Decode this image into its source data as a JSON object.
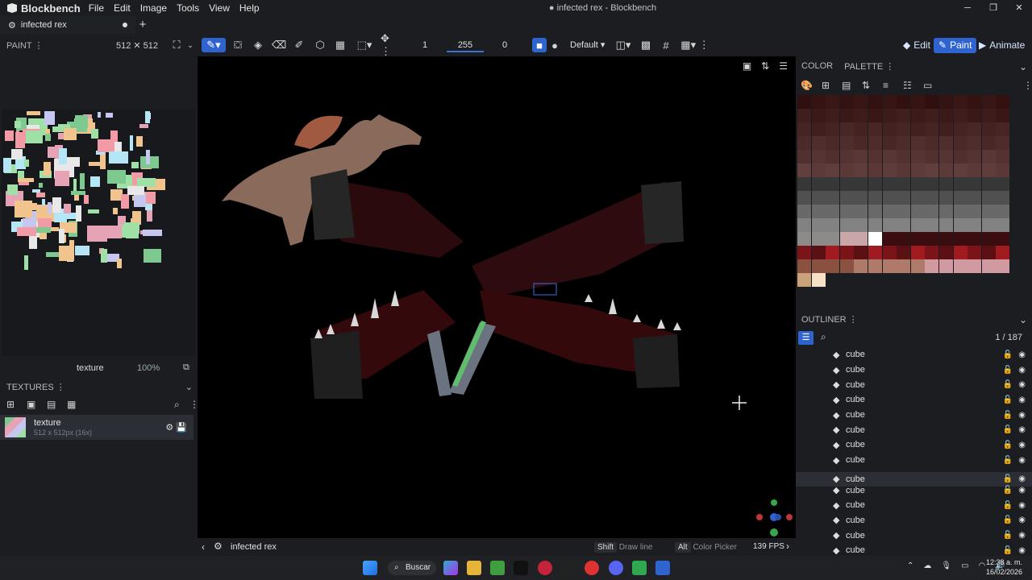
{
  "app": {
    "name": "Blockbench",
    "window_title": "infected rex - Blockbench"
  },
  "menu": [
    "File",
    "Edit",
    "Image",
    "Tools",
    "View",
    "Help"
  ],
  "window_controls": [
    "minimize-icon",
    "maximize-icon",
    "close-icon"
  ],
  "tab": {
    "label": "infected rex"
  },
  "toolbar": {
    "mode_label": "PAINT",
    "resolution": "512 ✕ 512",
    "brush_size": "1",
    "opacity": "255",
    "softness": "0",
    "blend_mode": "Default",
    "modes": [
      "Edit",
      "Paint",
      "Animate"
    ],
    "active_mode": "Paint"
  },
  "texture_panel": {
    "texture_name": "texture",
    "zoom": "100%",
    "header": "TEXTURES",
    "item": {
      "name": "texture",
      "meta": "512 x 512px (16x)"
    }
  },
  "viewport": {
    "status_name": "infected rex",
    "hint1_key": "Shift",
    "hint1_text": "Draw line",
    "hint2_key": "Alt",
    "hint2_text": "Color Picker",
    "fps": "139 FPS"
  },
  "color_panel": {
    "tabs": [
      "COLOR",
      "PALETTE"
    ]
  },
  "outliner": {
    "header": "OUTLINER",
    "count": "1 / 187",
    "items": [
      "cube",
      "cube",
      "cube",
      "cube",
      "cube",
      "cube",
      "cube",
      "cube",
      "cube",
      "cube",
      "cube",
      "cube",
      "cube",
      "cube"
    ],
    "selected_index": 8
  },
  "taskbar": {
    "search": "Buscar",
    "time": "12:38 a. m.",
    "date": "16/02/2026"
  },
  "colors": {
    "accent": "#2f63d0",
    "panel": "#1b1d21",
    "viewport": "#000000"
  }
}
